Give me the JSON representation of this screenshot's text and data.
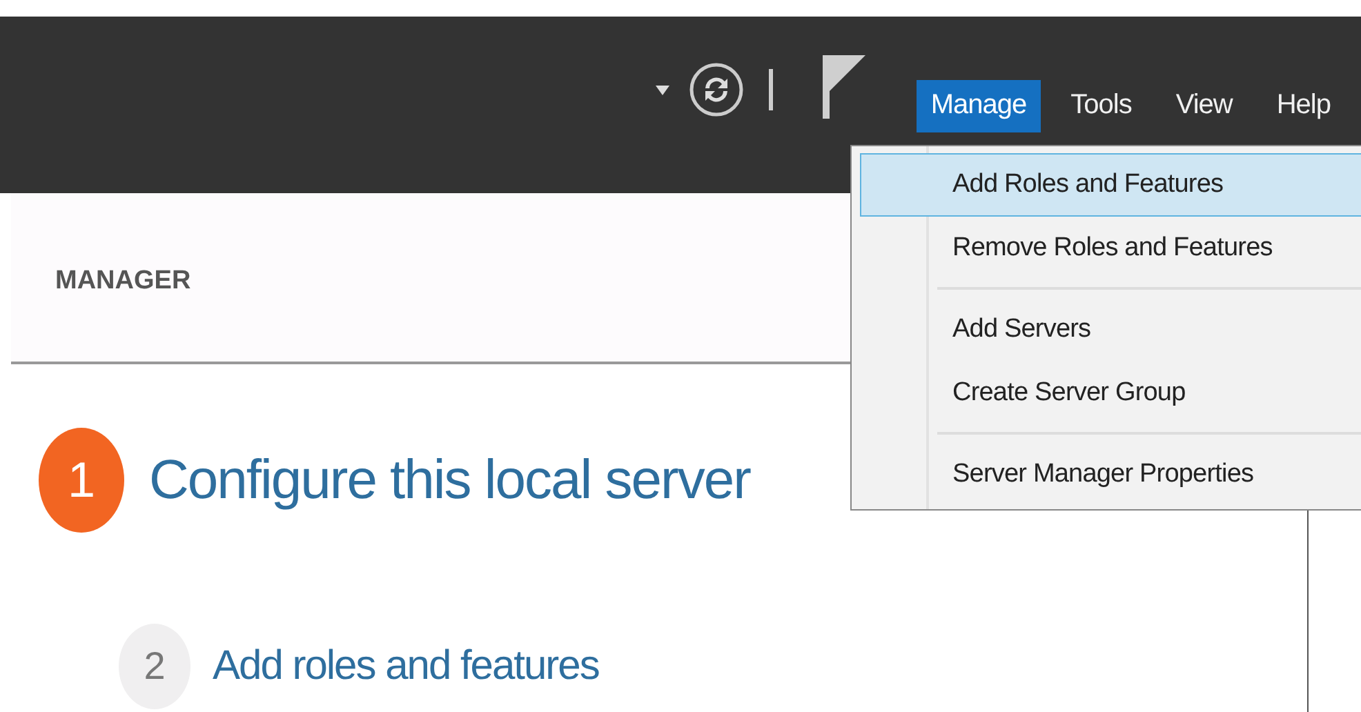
{
  "menubar": [
    {
      "label": "Manage",
      "selected": true
    },
    {
      "label": "Tools",
      "selected": false
    },
    {
      "label": "View",
      "selected": false
    },
    {
      "label": "Help",
      "selected": false
    }
  ],
  "header": {
    "title": "MANAGER"
  },
  "menu": {
    "groups": [
      {
        "items": [
          {
            "label": "Add Roles and Features",
            "selected": true
          },
          {
            "label": "Remove Roles and Features",
            "selected": false
          }
        ]
      },
      {
        "items": [
          {
            "label": "Add Servers",
            "selected": false
          },
          {
            "label": "Create Server Group",
            "selected": false
          }
        ]
      },
      {
        "items": [
          {
            "label": "Server Manager Properties",
            "selected": false
          }
        ]
      }
    ]
  },
  "steps": [
    {
      "number": "1",
      "label": "Configure this local server",
      "current": true
    },
    {
      "number": "2",
      "label": "Add roles and features",
      "current": false
    }
  ]
}
